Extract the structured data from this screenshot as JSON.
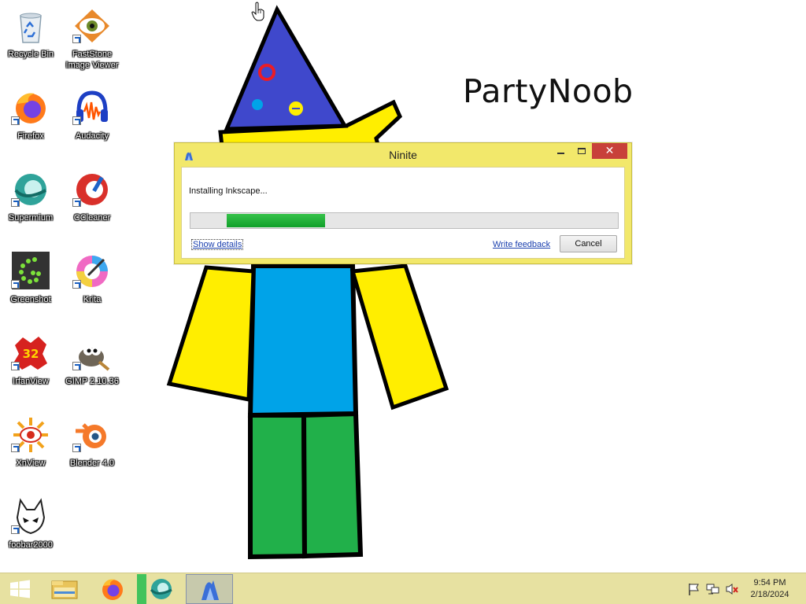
{
  "wallpaper": {
    "caption": "PartyNoob"
  },
  "desktop_icons": [
    {
      "label": "Recycle Bin"
    },
    {
      "label": "FastStone Image Viewer"
    },
    {
      "label": "Firefox"
    },
    {
      "label": "Audacity"
    },
    {
      "label": "Supermium"
    },
    {
      "label": "CCleaner"
    },
    {
      "label": "Greenshot"
    },
    {
      "label": "Krita"
    },
    {
      "label": "IrfanView"
    },
    {
      "label": "GIMP 2.10.36"
    },
    {
      "label": "XnView"
    },
    {
      "label": "Blender 4.0"
    },
    {
      "label": "foobar2000"
    }
  ],
  "ninite": {
    "title": "Ninite",
    "status": "Installing Inkscape...",
    "progress_fraction": 0.23,
    "show_details": "Show details",
    "write_feedback": "Write feedback",
    "cancel": "Cancel",
    "close_glyph": "✕"
  },
  "taskbar": {
    "items": [
      {
        "icon": "file-explorer-icon"
      },
      {
        "icon": "firefox-icon"
      },
      {
        "icon": "supermium-icon"
      },
      {
        "icon": "ninite-icon",
        "active": true
      }
    ],
    "clock": {
      "time": "9:54 PM",
      "date": "2/18/2024"
    }
  },
  "colors": {
    "window_frame": "#f2e86b",
    "progress_fill": "#11a02a",
    "taskbar": "#e7e1a1",
    "close_button": "#c8413a",
    "link": "#1a3fae"
  }
}
